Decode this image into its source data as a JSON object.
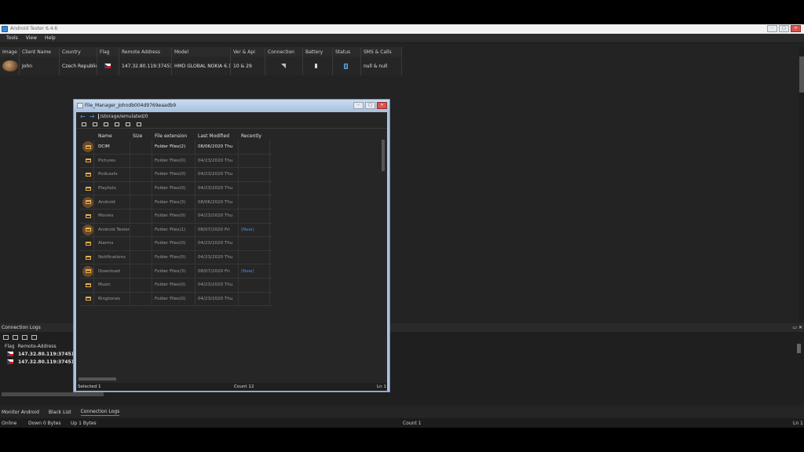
{
  "app": {
    "title": "Android Tester 6.4.6"
  },
  "menu": [
    "Tools",
    "View",
    "Help"
  ],
  "clients_table": {
    "headers": [
      "Image",
      "Client Name",
      "Country",
      "Flag",
      "Remote Address",
      "Model",
      "Ver & Api",
      "Connection",
      "Battery",
      "Status",
      "SMS & Calls"
    ],
    "row": {
      "client_name": "John",
      "country": "Czech Republic",
      "remote_address": "147.32.80.119:37451",
      "model": "HMD GLOBAL NOKIA 6.1",
      "ver_api": "10 & 29",
      "sms_calls": "null & null"
    }
  },
  "connection_logs": {
    "title": "Connection Logs",
    "headers": [
      "Flag",
      "Remote-Address"
    ],
    "rows": [
      "147.32.80.119:37451",
      "147.32.80.119:37451"
    ]
  },
  "bottom_tabs": [
    "Monitor Android",
    "Black List",
    "Connection Logs"
  ],
  "statusbar": {
    "online": "Online",
    "down": "Down 0 Bytes",
    "up": "Up 1 Bytes",
    "count": "Count 1",
    "line": "Ln 1"
  },
  "file_manager": {
    "title": "File_Manager_Johndb004d9769eaadb9",
    "path": "/storage/emulated/0",
    "headers": [
      "Name",
      "Size",
      "File extension",
      "Last Modified",
      "Recently"
    ],
    "rows": [
      {
        "name": "DCIM",
        "size": "",
        "ext": "Folder Files(2)",
        "modified": "08/06/2020 Thu",
        "recent": ""
      },
      {
        "name": "Pictures",
        "size": "",
        "ext": "Folder Files(0)",
        "modified": "04/23/2020 Thu",
        "recent": ""
      },
      {
        "name": "Podcasts",
        "size": "",
        "ext": "Folder Files(0)",
        "modified": "04/23/2020 Thu",
        "recent": ""
      },
      {
        "name": "Playlists",
        "size": "",
        "ext": "Folder Files(0)",
        "modified": "04/23/2020 Thu",
        "recent": ""
      },
      {
        "name": "Android",
        "size": "",
        "ext": "Folder Files(3)",
        "modified": "08/06/2020 Thu",
        "recent": ""
      },
      {
        "name": "Movies",
        "size": "",
        "ext": "Folder Files(0)",
        "modified": "04/23/2020 Thu",
        "recent": ""
      },
      {
        "name": "Android Tester",
        "size": "",
        "ext": "Folder Files(1)",
        "modified": "08/07/2020 Fri",
        "recent": "(New)"
      },
      {
        "name": "Alarms",
        "size": "",
        "ext": "Folder Files(0)",
        "modified": "04/23/2020 Thu",
        "recent": ""
      },
      {
        "name": "Notifications",
        "size": "",
        "ext": "Folder Files(0)",
        "modified": "04/23/2020 Thu",
        "recent": ""
      },
      {
        "name": "Download",
        "size": "",
        "ext": "Folder Files(3)",
        "modified": "08/07/2020 Fri",
        "recent": "(New)"
      },
      {
        "name": "Music",
        "size": "",
        "ext": "Folder Files(0)",
        "modified": "04/23/2020 Thu",
        "recent": ""
      },
      {
        "name": "Ringtones",
        "size": "",
        "ext": "Folder Files(0)",
        "modified": "04/23/2020 Thu",
        "recent": ""
      }
    ],
    "status": {
      "selected": "Selected 1",
      "count": "Count 12",
      "line": "Ln 1"
    }
  }
}
